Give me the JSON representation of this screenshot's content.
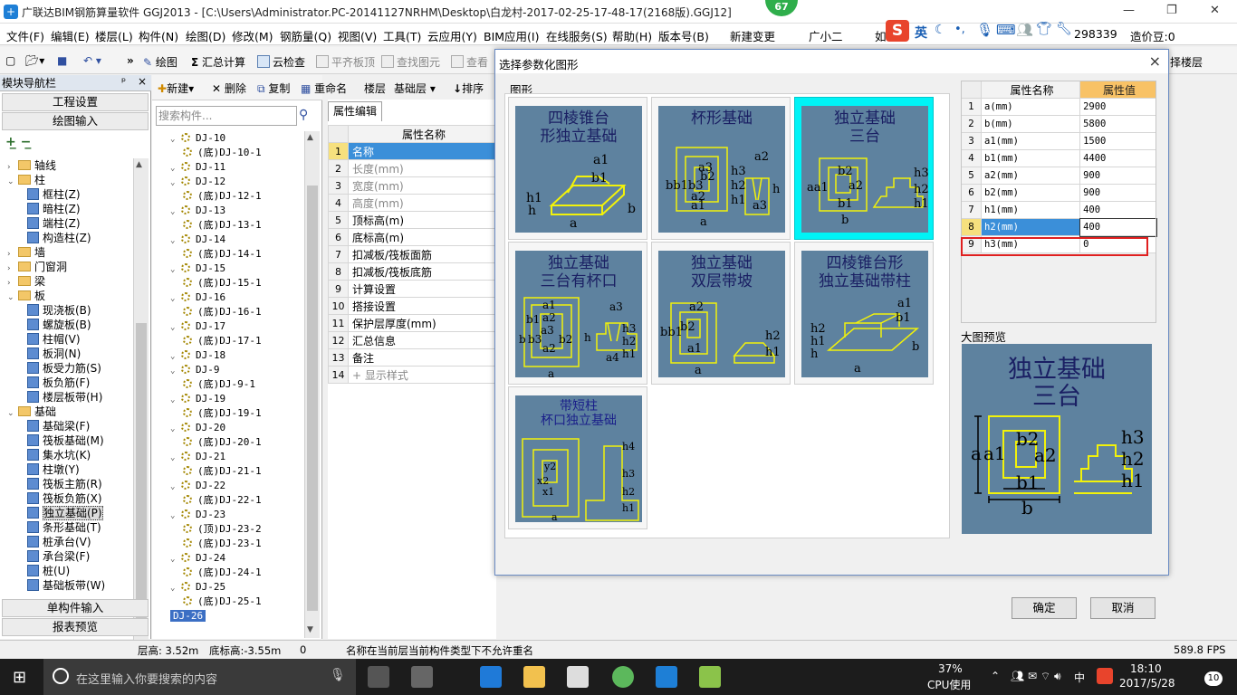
{
  "window": {
    "title": "广联达BIM钢筋算量软件 GGJ2013 - [C:\\Users\\Administrator.PC-20141127NRHM\\Desktop\\白龙村-2017-02-25-17-48-17(2168版).GGJ12]",
    "badge": "67"
  },
  "menu": [
    "文件(F)",
    "编辑(E)",
    "楼层(L)",
    "构件(N)",
    "绘图(D)",
    "修改(M)",
    "钢筋量(Q)",
    "视图(V)",
    "工具(T)",
    "云应用(Y)",
    "BIM应用(I)",
    "在线服务(S)",
    "帮助(H)",
    "版本号(B)",
    "新建变更",
    "广小二"
  ],
  "menu_right": {
    "like": "如",
    "ime_lang": "英",
    "account": "298339",
    "cost_bean": "造价豆:0"
  },
  "toolbar": {
    "draw": "绘图",
    "sum": "汇总计算",
    "cloud_check": "云检查",
    "flat_top": "平齐板顶",
    "find": "查找图元",
    "view": "查看",
    "floor_btn": "择楼层"
  },
  "nav": {
    "header": "模块导航栏",
    "pin": "ᵖ",
    "close": "×",
    "tabs": [
      "工程设置",
      "绘图输入"
    ],
    "bottom_tabs": [
      "单构件输入",
      "报表预览"
    ],
    "tree": [
      {
        "label": "轴线",
        "level": 0,
        "type": "folder",
        "expanded": false
      },
      {
        "label": "柱",
        "level": 0,
        "type": "folder",
        "expanded": true
      },
      {
        "label": "框柱(Z)",
        "level": 1,
        "type": "leaf"
      },
      {
        "label": "暗柱(Z)",
        "level": 1,
        "type": "leaf"
      },
      {
        "label": "端柱(Z)",
        "level": 1,
        "type": "leaf"
      },
      {
        "label": "构造柱(Z)",
        "level": 1,
        "type": "leaf"
      },
      {
        "label": "墙",
        "level": 0,
        "type": "folder",
        "expanded": false
      },
      {
        "label": "门窗洞",
        "level": 0,
        "type": "folder",
        "expanded": false
      },
      {
        "label": "梁",
        "level": 0,
        "type": "folder",
        "expanded": false
      },
      {
        "label": "板",
        "level": 0,
        "type": "folder",
        "expanded": true
      },
      {
        "label": "现浇板(B)",
        "level": 1,
        "type": "leaf"
      },
      {
        "label": "螺旋板(B)",
        "level": 1,
        "type": "leaf"
      },
      {
        "label": "柱帽(V)",
        "level": 1,
        "type": "leaf"
      },
      {
        "label": "板洞(N)",
        "level": 1,
        "type": "leaf"
      },
      {
        "label": "板受力筋(S)",
        "level": 1,
        "type": "leaf"
      },
      {
        "label": "板负筋(F)",
        "level": 1,
        "type": "leaf"
      },
      {
        "label": "楼层板带(H)",
        "level": 1,
        "type": "leaf"
      },
      {
        "label": "基础",
        "level": 0,
        "type": "folder",
        "expanded": true
      },
      {
        "label": "基础梁(F)",
        "level": 1,
        "type": "leaf"
      },
      {
        "label": "筏板基础(M)",
        "level": 1,
        "type": "leaf"
      },
      {
        "label": "集水坑(K)",
        "level": 1,
        "type": "leaf"
      },
      {
        "label": "柱墩(Y)",
        "level": 1,
        "type": "leaf"
      },
      {
        "label": "筏板主筋(R)",
        "level": 1,
        "type": "leaf"
      },
      {
        "label": "筏板负筋(X)",
        "level": 1,
        "type": "leaf"
      },
      {
        "label": "独立基础(P)",
        "level": 1,
        "type": "leaf",
        "selected": true
      },
      {
        "label": "条形基础(T)",
        "level": 1,
        "type": "leaf"
      },
      {
        "label": "桩承台(V)",
        "level": 1,
        "type": "leaf"
      },
      {
        "label": "承台梁(F)",
        "level": 1,
        "type": "leaf"
      },
      {
        "label": "桩(U)",
        "level": 1,
        "type": "leaf"
      },
      {
        "label": "基础板带(W)",
        "level": 1,
        "type": "leaf"
      }
    ]
  },
  "components": {
    "toolbar": {
      "new": "新建",
      "delete": "删除",
      "copy": "复制",
      "rename": "重命名",
      "floor_label": "楼层",
      "floor_value": "基础层",
      "sort": "排序"
    },
    "search_placeholder": "搜索构件...",
    "items": [
      {
        "label": "DJ-10",
        "level": 0
      },
      {
        "label": "(底)DJ-10-1",
        "level": 1
      },
      {
        "label": "DJ-11",
        "level": 0
      },
      {
        "label": "DJ-12",
        "level": 0
      },
      {
        "label": "(底)DJ-12-1",
        "level": 1
      },
      {
        "label": "DJ-13",
        "level": 0
      },
      {
        "label": "(底)DJ-13-1",
        "level": 1
      },
      {
        "label": "DJ-14",
        "level": 0
      },
      {
        "label": "(底)DJ-14-1",
        "level": 1
      },
      {
        "label": "DJ-15",
        "level": 0
      },
      {
        "label": "(底)DJ-15-1",
        "level": 1
      },
      {
        "label": "DJ-16",
        "level": 0
      },
      {
        "label": "(底)DJ-16-1",
        "level": 1
      },
      {
        "label": "DJ-17",
        "level": 0
      },
      {
        "label": "(底)DJ-17-1",
        "level": 1
      },
      {
        "label": "DJ-18",
        "level": 0
      },
      {
        "label": "DJ-9",
        "level": 0
      },
      {
        "label": "(底)DJ-9-1",
        "level": 1
      },
      {
        "label": "DJ-19",
        "level": 0
      },
      {
        "label": "(底)DJ-19-1",
        "level": 1
      },
      {
        "label": "DJ-20",
        "level": 0
      },
      {
        "label": "(底)DJ-20-1",
        "level": 1
      },
      {
        "label": "DJ-21",
        "level": 0
      },
      {
        "label": "(底)DJ-21-1",
        "level": 1
      },
      {
        "label": "DJ-22",
        "level": 0
      },
      {
        "label": "(底)DJ-22-1",
        "level": 1
      },
      {
        "label": "DJ-23",
        "level": 0
      },
      {
        "label": "(顶)DJ-23-2",
        "level": 1
      },
      {
        "label": "(底)DJ-23-1",
        "level": 1
      },
      {
        "label": "DJ-24",
        "level": 0
      },
      {
        "label": "(底)DJ-24-1",
        "level": 1
      },
      {
        "label": "DJ-25",
        "level": 0
      },
      {
        "label": "(底)DJ-25-1",
        "level": 1
      },
      {
        "label": "DJ-26",
        "level": 0,
        "selected": true
      }
    ]
  },
  "properties": {
    "tab": "属性编辑",
    "header": "属性名称",
    "rows": [
      {
        "num": "1",
        "name": "名称",
        "selected": true
      },
      {
        "num": "2",
        "name": "长度(mm)",
        "gray": true
      },
      {
        "num": "3",
        "name": "宽度(mm)",
        "gray": true
      },
      {
        "num": "4",
        "name": "高度(mm)",
        "gray": true
      },
      {
        "num": "5",
        "name": "顶标高(m)"
      },
      {
        "num": "6",
        "name": "底标高(m)"
      },
      {
        "num": "7",
        "name": "扣减板/筏板面筋"
      },
      {
        "num": "8",
        "name": "扣减板/筏板底筋"
      },
      {
        "num": "9",
        "name": "计算设置"
      },
      {
        "num": "10",
        "name": "搭接设置"
      },
      {
        "num": "11",
        "name": "保护层厚度(mm)"
      },
      {
        "num": "12",
        "name": "汇总信息"
      },
      {
        "num": "13",
        "name": "备注"
      },
      {
        "num": "14",
        "name": "+ 显示样式",
        "gray": true
      }
    ]
  },
  "dialog": {
    "title": "选择参数化图形",
    "close": "×",
    "group_label": "图形",
    "shapes": [
      {
        "title": "四棱锥台\n形独立基础"
      },
      {
        "title": "杯形基础"
      },
      {
        "title": "独立基础\n三台",
        "selected": true
      },
      {
        "title": "独立基础\n三台有杯口"
      },
      {
        "title": "独立基础\n双层带坡"
      },
      {
        "title": "四棱锥台形\n独立基础带柱"
      },
      {
        "title": "带短柱\n杯口独立基础"
      }
    ],
    "attr_header": {
      "name": "属性名称",
      "value": "属性值"
    },
    "attrs": [
      {
        "num": "1",
        "name": "a(mm)",
        "value": "2900"
      },
      {
        "num": "2",
        "name": "b(mm)",
        "value": "5800"
      },
      {
        "num": "3",
        "name": "a1(mm)",
        "value": "1500"
      },
      {
        "num": "4",
        "name": "b1(mm)",
        "value": "4400"
      },
      {
        "num": "5",
        "name": "a2(mm)",
        "value": "900"
      },
      {
        "num": "6",
        "name": "b2(mm)",
        "value": "900"
      },
      {
        "num": "7",
        "name": "h1(mm)",
        "value": "400"
      },
      {
        "num": "8",
        "name": "h2(mm)",
        "value": "400",
        "selected": true
      },
      {
        "num": "9",
        "name": "h3(mm)",
        "value": "0",
        "highlighted": true
      }
    ],
    "preview_label": "大图预览",
    "preview_title": "独立基础\n三台",
    "ok": "确定",
    "cancel": "取消"
  },
  "status": {
    "floor_height": "层高: 3.52m",
    "bottom_elev": "底标高:-3.55m",
    "zero": "0",
    "message": "名称在当前层当前构件类型下不允许重名",
    "fps": "589.8 FPS"
  },
  "taskbar": {
    "search_placeholder": "在这里输入你要搜索的内容",
    "cpu_percent": "37%",
    "cpu_label": "CPU使用",
    "lang": "中",
    "time": "18:10",
    "date": "2017/5/28",
    "notify_count": "10"
  },
  "colors": {
    "shape_bg": "#5e829f",
    "shape_line": "#f2f20a",
    "shape_title": "#1a1f63",
    "selected_cyan": "#00f3f6",
    "highlight_red": "#e02020",
    "value_header": "#f8c266"
  }
}
